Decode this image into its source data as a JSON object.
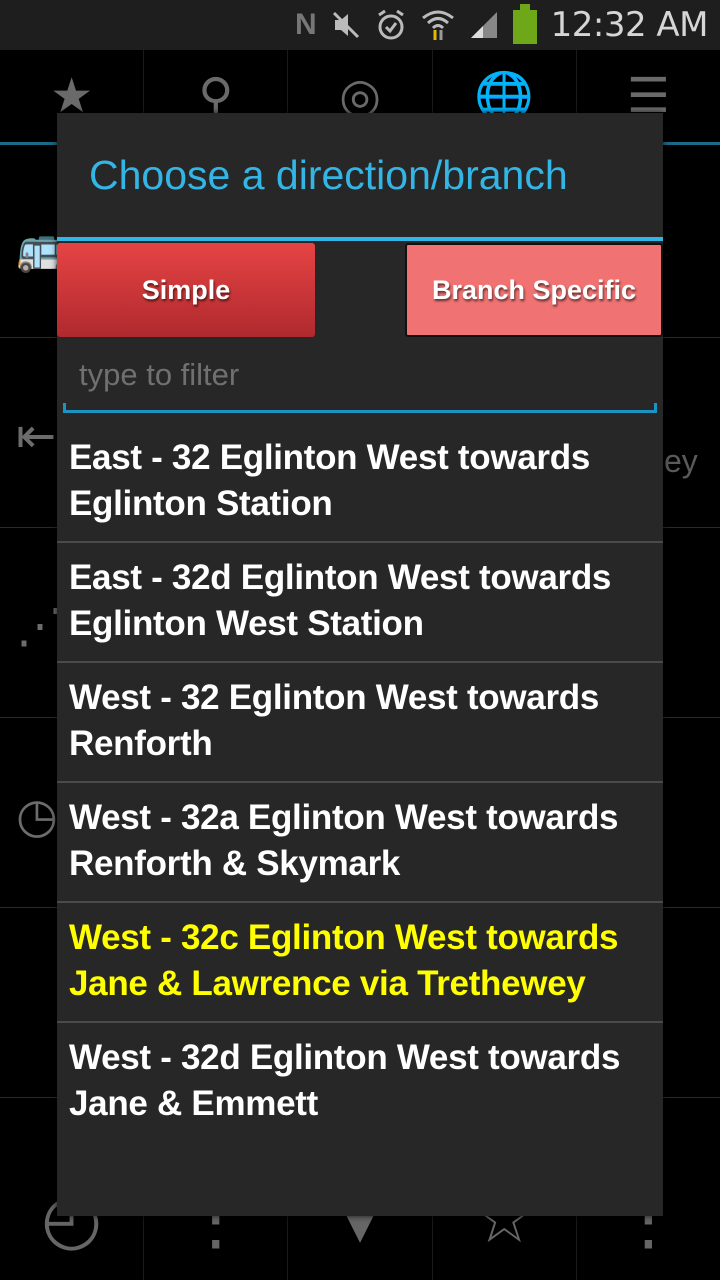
{
  "status_bar": {
    "time": "12:32 AM",
    "icons": [
      "nfc-icon",
      "mute-icon",
      "alarm-icon",
      "wifi-icon",
      "signal-icon",
      "battery-icon"
    ]
  },
  "background_app": {
    "top_tabs": [
      {
        "name": "favorites",
        "icon": "★"
      },
      {
        "name": "search",
        "icon": "⚲"
      },
      {
        "name": "location",
        "icon": "◎"
      },
      {
        "name": "globe",
        "icon": "🌐"
      },
      {
        "name": "list",
        "icon": "☰"
      }
    ],
    "rows": [
      {
        "icon": "bus-icon",
        "glyph": "🚌",
        "text": ""
      },
      {
        "icon": "signpost-icon",
        "glyph": "⇤",
        "text": "ey"
      },
      {
        "icon": "route-icon",
        "glyph": "⋰",
        "text": ""
      },
      {
        "icon": "clock-icon",
        "glyph": "◷",
        "text": ""
      },
      {
        "icon": "",
        "glyph": "",
        "text": ""
      }
    ],
    "bottom_tabs": [
      {
        "name": "history",
        "icon": "◴"
      },
      {
        "name": "ruler",
        "icon": "⋮"
      },
      {
        "name": "pin",
        "icon": "▼"
      },
      {
        "name": "star",
        "icon": "☆"
      },
      {
        "name": "overflow",
        "icon": "⋮"
      }
    ]
  },
  "dialog": {
    "title": "Choose a direction/branch",
    "accent_color": "#33b5e5",
    "simple_label": "Simple",
    "branch_label": "Branch Specific",
    "filter_placeholder": "type to filter",
    "filter_value": "",
    "items": [
      {
        "label": "East - 32 Eglinton West towards Eglinton Station",
        "highlighted": false
      },
      {
        "label": "East - 32d Eglinton West towards Eglinton West Station",
        "highlighted": false
      },
      {
        "label": "West - 32 Eglinton West towards Renforth",
        "highlighted": false
      },
      {
        "label": "West - 32a Eglinton West towards Renforth & Skymark",
        "highlighted": false
      },
      {
        "label": "West - 32c Eglinton West towards Jane & Lawrence via Trethewey",
        "highlighted": true
      },
      {
        "label": "West - 32d Eglinton West towards Jane & Emmett",
        "highlighted": false
      }
    ],
    "highlight_color": "#ffff00"
  }
}
